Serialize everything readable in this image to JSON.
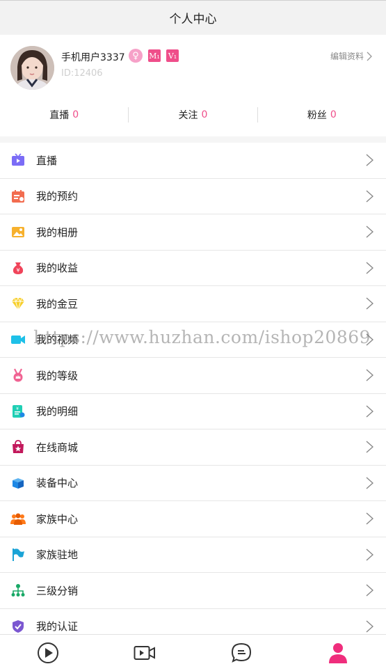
{
  "header": {
    "title": "个人中心"
  },
  "profile": {
    "username": "手机用户3337",
    "badge_sex": "♀",
    "badge_level_m": "M₁",
    "badge_level_v": "V₁",
    "user_id": "ID:12406",
    "edit_label": "编辑资料"
  },
  "stats": [
    {
      "label": "直播",
      "value": "0"
    },
    {
      "label": "关注",
      "value": "0"
    },
    {
      "label": "粉丝",
      "value": "0"
    }
  ],
  "menu": [
    {
      "label": "直播",
      "icon": "live-tv-icon",
      "color": "#7b6cf6"
    },
    {
      "label": "我的预约",
      "icon": "calendar-icon",
      "color": "#f26c4f"
    },
    {
      "label": "我的相册",
      "icon": "photo-icon",
      "color": "#f7b12d"
    },
    {
      "label": "我的收益",
      "icon": "money-bag-icon",
      "color": "#f0445a"
    },
    {
      "label": "我的金豆",
      "icon": "diamond-icon",
      "color": "#f7cf2b"
    },
    {
      "label": "我的视频",
      "icon": "video-camera-icon",
      "color": "#1ec0e8"
    },
    {
      "label": "我的等级",
      "icon": "medal-icon",
      "color": "#f06292"
    },
    {
      "label": "我的明细",
      "icon": "receipt-icon",
      "color": "#1fcfb4"
    },
    {
      "label": "在线商城",
      "icon": "shop-bag-icon",
      "color": "#c2185b"
    },
    {
      "label": "装备中心",
      "icon": "box-icon",
      "color": "#1e88e5"
    },
    {
      "label": "家族中心",
      "icon": "family-icon",
      "color": "#ff7a1a"
    },
    {
      "label": "家族驻地",
      "icon": "flag-icon",
      "color": "#1aa3d6"
    },
    {
      "label": "三级分销",
      "icon": "hierarchy-icon",
      "color": "#18a866"
    },
    {
      "label": "我的认证",
      "icon": "shield-check-icon",
      "color": "#7b57d1"
    }
  ],
  "watermark": "https://www.huzhan.com/ishop20869",
  "tabbar": [
    {
      "icon": "play-circle-icon"
    },
    {
      "icon": "video-camera-icon"
    },
    {
      "icon": "chat-bubble-icon"
    },
    {
      "icon": "user-icon",
      "active": true
    }
  ],
  "colors": {
    "accent": "#ef4e8a",
    "active_tab": "#ef2d7c"
  }
}
